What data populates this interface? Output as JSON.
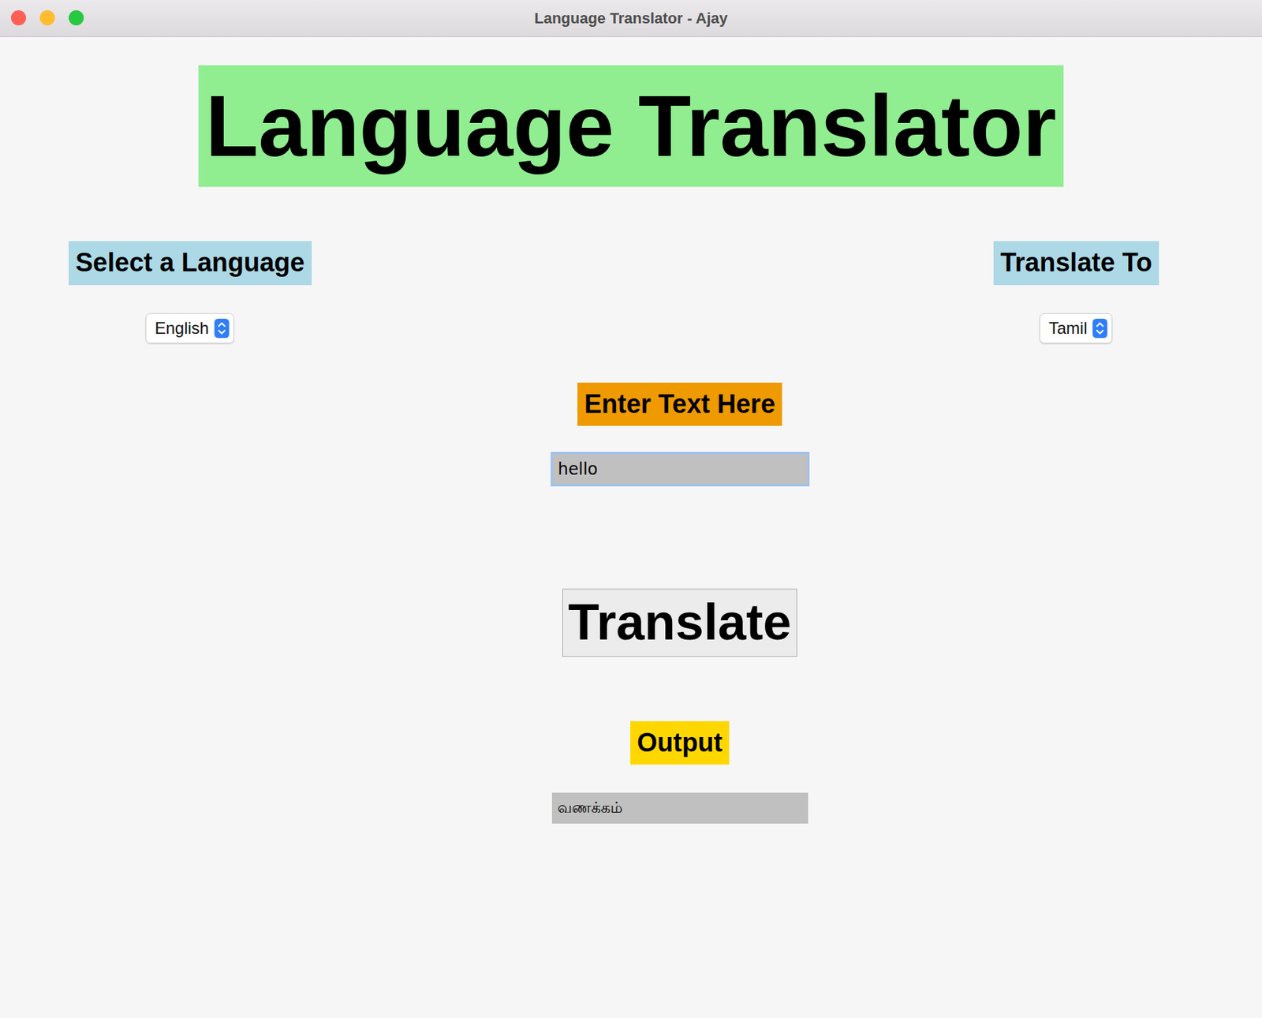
{
  "window": {
    "title": "Language Translator - Ajay"
  },
  "heading": "Language Translator",
  "source": {
    "label": "Select a Language",
    "value": "English"
  },
  "target": {
    "label": "Translate To",
    "value": "Tamil"
  },
  "input": {
    "label": "Enter Text Here",
    "value": "hello",
    "focused": true
  },
  "button": "Translate",
  "output": {
    "label": "Output",
    "value": "வணக்கம்"
  }
}
